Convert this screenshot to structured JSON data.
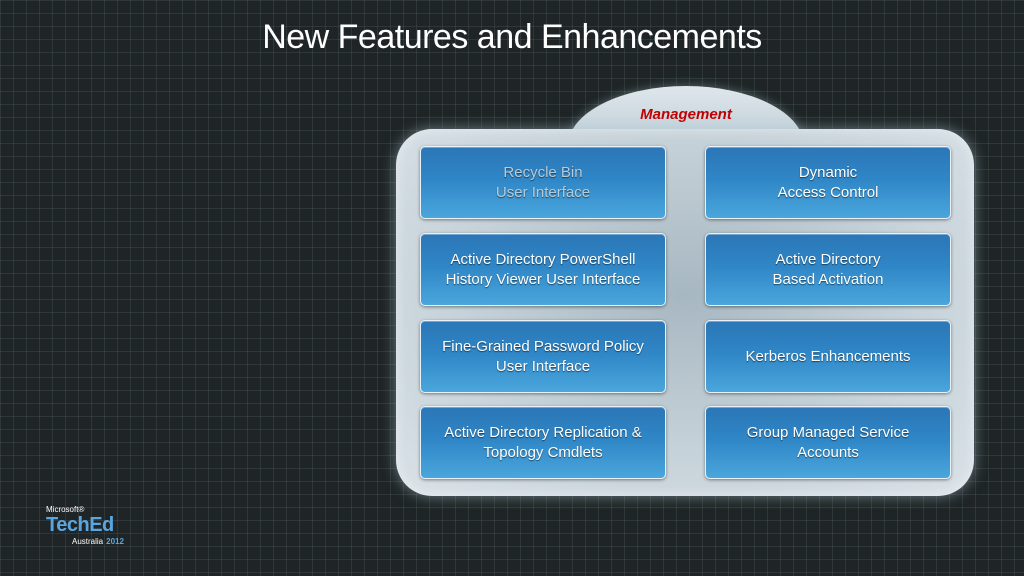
{
  "slide": {
    "title": "New Features and Enhancements"
  },
  "panel": {
    "tab_label": "Management",
    "tiles": [
      {
        "label": "Recycle Bin\nUser Interface"
      },
      {
        "label": "Dynamic\nAccess Control"
      },
      {
        "label": "Active Directory PowerShell\nHistory Viewer User Interface"
      },
      {
        "label": "Active Directory\nBased Activation"
      },
      {
        "label": "Fine-Grained Password Policy\nUser Interface"
      },
      {
        "label": "Kerberos Enhancements"
      },
      {
        "label": "Active Directory Replication &\nTopology Cmdlets"
      },
      {
        "label": "Group Managed Service\nAccounts"
      }
    ]
  },
  "logo": {
    "brand": "Microsoft®",
    "name": "TechEd",
    "region": "Australia",
    "year": "2012"
  },
  "colors": {
    "tile_blue": "#2f86c6",
    "tab_label_red": "#c00000",
    "logo_blue": "#5aa7e0"
  }
}
